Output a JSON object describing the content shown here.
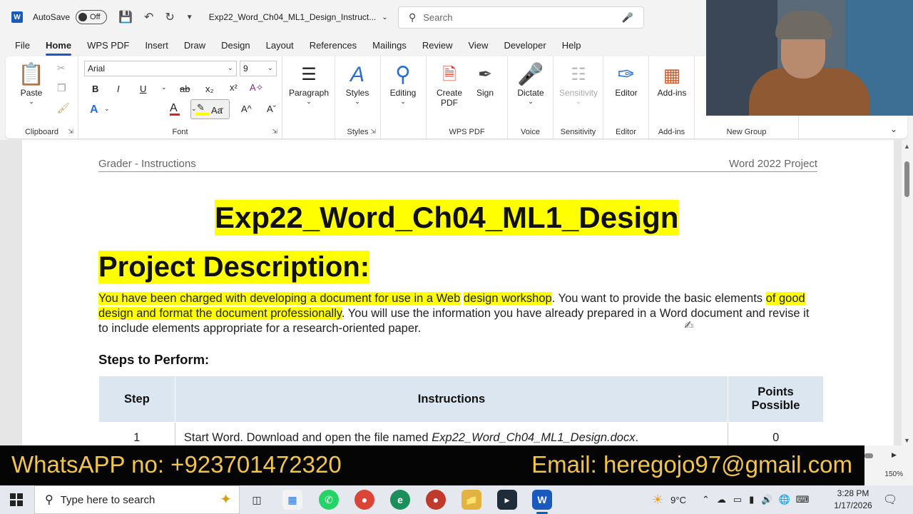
{
  "titlebar": {
    "autosave_label": "AutoSave",
    "autosave_state": "Off",
    "document_title": "Exp22_Word_Ch04_ML1_Design_Instruct...",
    "search_placeholder": "Search"
  },
  "menu": {
    "tabs": [
      "File",
      "Home",
      "WPS PDF",
      "Insert",
      "Draw",
      "Design",
      "Layout",
      "References",
      "Mailings",
      "Review",
      "View",
      "Developer",
      "Help"
    ],
    "active": "Home"
  },
  "ribbon": {
    "clipboard": {
      "paste": "Paste",
      "label": "Clipboard"
    },
    "font": {
      "family": "Arial",
      "size": "9",
      "label": "Font",
      "bold": "B",
      "italic": "I",
      "underline": "U",
      "strike": "ab",
      "subscript": "x₂",
      "superscript": "x²",
      "change_case": "Aa",
      "grow": "A^",
      "shrink": "Aˇ"
    },
    "paragraph": {
      "label": "Paragraph"
    },
    "styles": {
      "button": "Styles",
      "label": "Styles"
    },
    "editing": {
      "button": "Editing"
    },
    "wps_pdf": {
      "create": "Create PDF",
      "sign": "Sign",
      "label": "WPS PDF"
    },
    "voice": {
      "dictate": "Dictate",
      "label": "Voice"
    },
    "sensitivity": {
      "button": "Sensitivity",
      "label": "Sensitivity"
    },
    "editor": {
      "button": "Editor",
      "label": "Editor"
    },
    "addins": {
      "button": "Add-ins",
      "label": "Add-ins"
    },
    "newgroup": {
      "label": "New Group"
    }
  },
  "document": {
    "header_left": "Grader - Instructions",
    "header_right": "Word 2022 Project",
    "title": "Exp22_Word_Ch04_ML1_Design",
    "project_heading": "Project Description:",
    "para_hl_1": "You have been charged with developing a document for use in a Web",
    "para_hl_2": "design  workshop",
    "para_text_1": ". You want to provide the basic elements ",
    "para_hl_3": "of good design and format the document professionally",
    "para_text_2": ". You will use the information you have already prepared in a Word document and revise it to include elements appropriate for a research-oriented paper.",
    "steps_heading": "Steps to Perform:",
    "table": {
      "headers": [
        "Step",
        "Instructions",
        "Points Possible"
      ],
      "rows": [
        {
          "step": "1",
          "instr_a": "Start Word. Download and open the file named ",
          "instr_file": "Exp22_Word_Ch04_ML1_Design.docx",
          "instr_b": ".",
          "points": "0"
        }
      ]
    }
  },
  "banner": {
    "whatsapp": "WhatsAPP no: +923701472320",
    "email": "Email: heregojo97@gmail.com"
  },
  "status": {
    "zoom": "150%"
  },
  "taskbar": {
    "search_placeholder": "Type here to search",
    "weather": "9°C",
    "time": "3:28 PM",
    "date": "1/17/2026"
  },
  "colors": {
    "accent": "#185abd",
    "highlight": "#ffff00",
    "banner_text": "#f3c44a",
    "table_header": "#dce6f0"
  }
}
